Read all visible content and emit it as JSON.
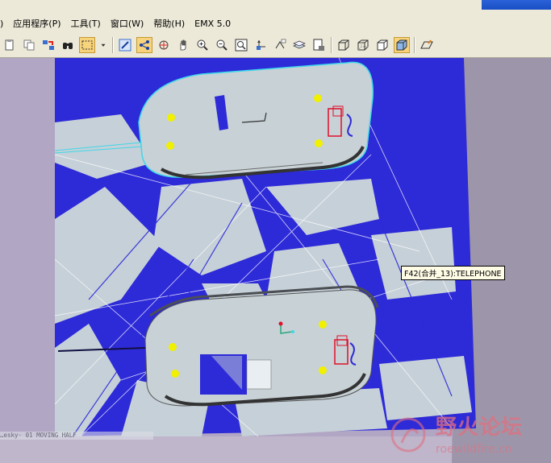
{
  "menu": {
    "items": [
      {
        "label": ")"
      },
      {
        "label": "应用程序(P)"
      },
      {
        "label": "工具(T)"
      },
      {
        "label": "窗口(W)"
      },
      {
        "label": "帮助(H)"
      },
      {
        "label": "EMX 5.0"
      }
    ]
  },
  "toolbar": {
    "icons": [
      "paste-icon",
      "copy-icon",
      "regen-icon",
      "find-icon",
      "select-box-icon",
      "dropdown-arrow-icon",
      "sketch-icon",
      "datum-display-icon",
      "spin-icon",
      "pan-icon",
      "zoom-in-icon",
      "zoom-out-icon",
      "refit-icon",
      "orient-icon",
      "named-view-icon",
      "layers-icon",
      "view-manager-icon",
      "wireframe-icon",
      "hidden-line-icon",
      "no-hidden-icon",
      "shading-icon",
      "datum-plane-icon"
    ]
  },
  "viewport": {
    "tooltip": "F42(合并_13):TELEPHONE",
    "status_text": "…esky· 01 MOVING HALF"
  },
  "watermark": {
    "title": "野火论坛",
    "url": "roewildfire.cn"
  },
  "colors": {
    "model_blue": "#2a2ad6",
    "part_gray": "#c8d2d8",
    "highlight_cyan": "#3fd8e8",
    "yellow_marker": "#f0f000",
    "red_feature": "#e0102a"
  }
}
